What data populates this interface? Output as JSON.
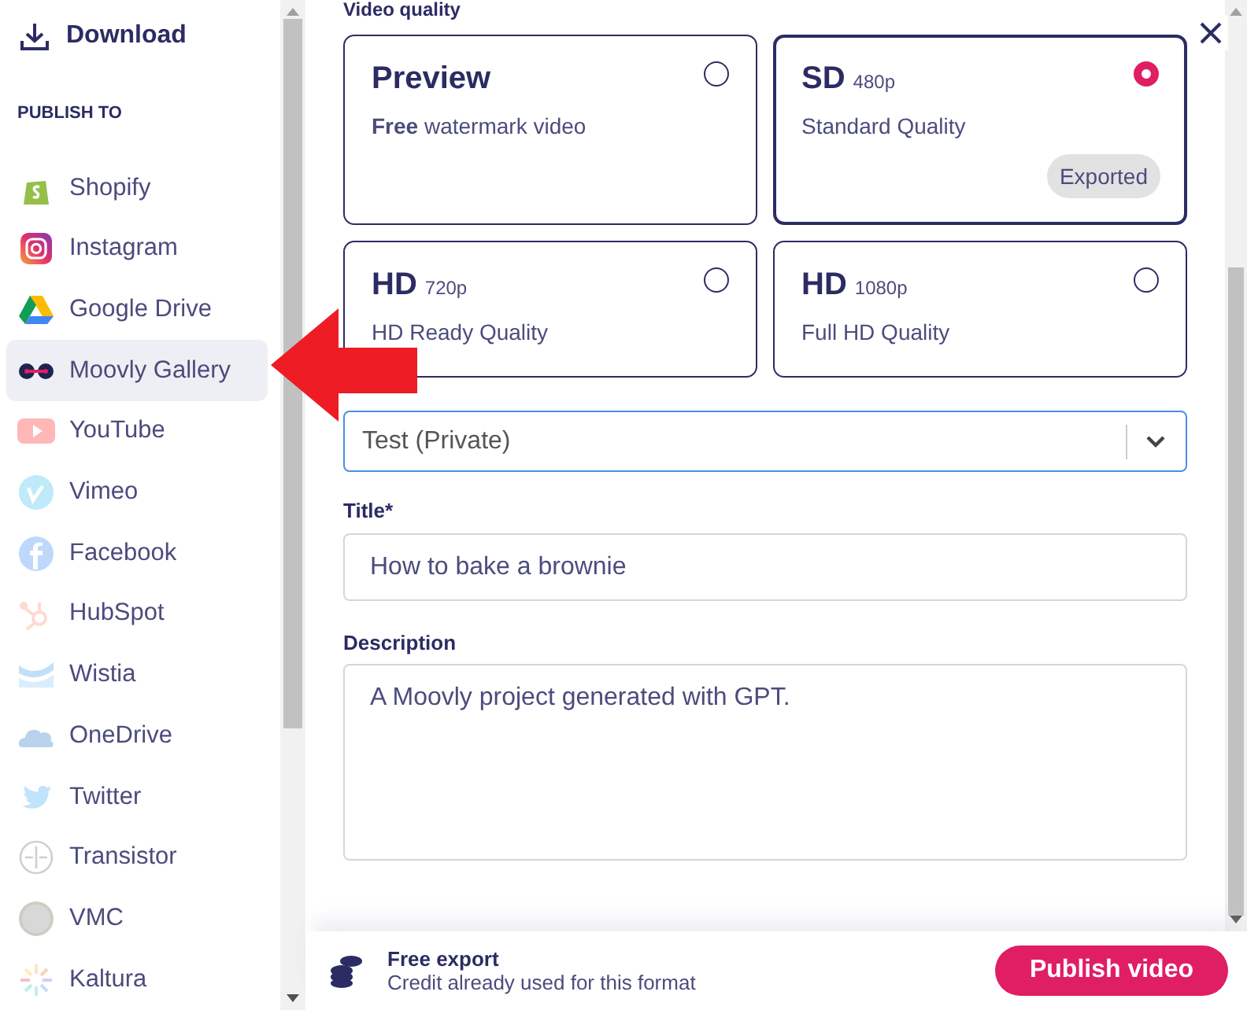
{
  "sidebar": {
    "download": "Download",
    "section_title": "PUBLISH TO",
    "items": [
      {
        "label": "Shopify",
        "selected": false,
        "faded": false
      },
      {
        "label": "Instagram",
        "selected": false,
        "faded": false
      },
      {
        "label": "Google Drive",
        "selected": false,
        "faded": false
      },
      {
        "label": "Moovly Gallery",
        "selected": true,
        "faded": false
      },
      {
        "label": "YouTube",
        "selected": false,
        "faded": true
      },
      {
        "label": "Vimeo",
        "selected": false,
        "faded": true
      },
      {
        "label": "Facebook",
        "selected": false,
        "faded": true
      },
      {
        "label": "HubSpot",
        "selected": false,
        "faded": true
      },
      {
        "label": "Wistia",
        "selected": false,
        "faded": true
      },
      {
        "label": "OneDrive",
        "selected": false,
        "faded": true
      },
      {
        "label": "Twitter",
        "selected": false,
        "faded": true
      },
      {
        "label": "Transistor",
        "selected": false,
        "faded": true
      },
      {
        "label": "VMC",
        "selected": false,
        "faded": true
      },
      {
        "label": "Kaltura",
        "selected": false,
        "faded": true
      }
    ]
  },
  "quality": {
    "label": "Video quality",
    "options": [
      {
        "name": "Preview",
        "description": "**Free** watermark video",
        "selected": false
      },
      {
        "name": "SD",
        "resolution": "480p",
        "description": "Standard Quality",
        "selected": true,
        "badge": "Exported"
      },
      {
        "name": "HD",
        "resolution": "720p",
        "description": "HD Ready Quality",
        "selected": false
      },
      {
        "name": "HD",
        "resolution": "1080p",
        "description": "Full HD Quality",
        "selected": false
      }
    ]
  },
  "gallery_select": {
    "value": "Test (Private)",
    "focused": true
  },
  "title_field": {
    "label": "Title*",
    "value": "How to bake a brownie"
  },
  "description_field": {
    "label": "Description",
    "value": "A Moovly project generated with GPT."
  },
  "footer": {
    "heading": "Free export",
    "note": "Credit already used for this format",
    "button": "Publish video"
  }
}
